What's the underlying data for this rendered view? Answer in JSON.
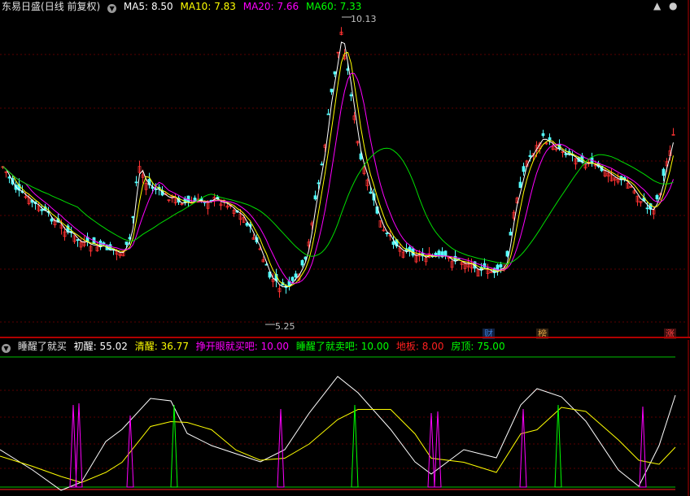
{
  "header": {
    "stock_name": "东易日盛",
    "period": "(日线 前复权)",
    "ma5": {
      "label": "MA5:",
      "value": "8.50",
      "color": "#ffffff"
    },
    "ma10": {
      "label": "MA10:",
      "value": "7.83",
      "color": "#ffff00"
    },
    "ma20": {
      "label": "MA20:",
      "value": "7.66",
      "color": "#ff00ff"
    },
    "ma60": {
      "label": "MA60:",
      "value": "7.33",
      "color": "#00ff00"
    }
  },
  "price_marks": {
    "high": "10.13",
    "low": "5.25"
  },
  "badges": [
    {
      "text": "财",
      "color": "#3a7bd5"
    },
    {
      "text": "榜",
      "color": "#e0a040"
    },
    {
      "text": "涨",
      "color": "#ff4040"
    }
  ],
  "indicator": {
    "name": "睡醒了就买",
    "items": [
      {
        "label": "初醒:",
        "value": "55.02",
        "color": "#ffffff"
      },
      {
        "label": "清醒:",
        "value": "36.77",
        "color": "#ffff00"
      },
      {
        "label": "挣开眼就买吧:",
        "value": "10.00",
        "color": "#ff00ff"
      },
      {
        "label": "睡醒了就卖吧:",
        "value": "10.00",
        "color": "#00ff00"
      },
      {
        "label": "地板:",
        "value": "8.00",
        "color": "#ff2020"
      },
      {
        "label": "房顶:",
        "value": "75.00",
        "color": "#00ff00"
      }
    ]
  },
  "toolbar": {
    "up_icon": "▲",
    "close_icon": "●"
  }
}
